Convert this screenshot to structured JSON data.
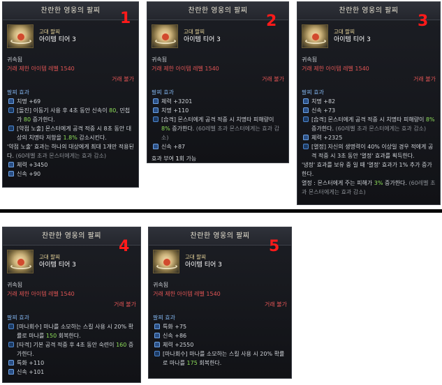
{
  "panels": [
    {
      "number": "1",
      "title": "찬란한 영웅의 팔찌",
      "grade": "고대 팔찌",
      "tier": "아이템 티어 3",
      "bound": "귀속됨",
      "req": "거래 제한 아이템 레벨 1540",
      "trade": "거래 불가",
      "effect_title": "팔찌 효과",
      "lines": [
        {
          "icon": "lock-icon",
          "text": "치명 +69"
        },
        {
          "icon": "effect-icon",
          "pre": "[돌진] 이동기 사용 후 4초 동안 신속이 ",
          "g1": "80",
          "mid": ", 민첩가 ",
          "g2": "80",
          "post": " 증가한다."
        },
        {
          "icon": "effect-icon",
          "pre": "[약점 노출] 몬스터에게 공격 적중 시 8초 동안 대상의 치명타 저항을 ",
          "g1": "1.8%",
          "post": " 감소시킨다."
        },
        {
          "icon": "",
          "text": "'약점 노출' 효과는 하나의 대상에게 최대 1개만 적용된다.",
          "sub": " (60레벨 초과 몬스터에게는 효과 감소)"
        },
        {
          "icon": "lock-icon",
          "text": "체력 +3450"
        },
        {
          "icon": "lock-icon",
          "text": "신속 +90"
        }
      ]
    },
    {
      "number": "2",
      "title": "찬란한 영웅의 팔찌",
      "grade": "고대 팔찌",
      "tier": "아이템 티어 3",
      "bound": "귀속됨",
      "req": "거래 제한 아이템 레벨 1540",
      "trade": "거래 불가",
      "effect_title": "팔찌 효과",
      "lines": [
        {
          "icon": "lock-icon",
          "text": "체력 +3201"
        },
        {
          "icon": "lock-icon",
          "text": "치명 +110"
        },
        {
          "icon": "effect-icon",
          "pre": "[습격] 몬스터에게 공격 적중 시 치명타 피해량이 ",
          "g1": "8%",
          "post": " 증가한다.",
          "sub": " (60레벨 초과 몬스터에게는 효과 감소)"
        },
        {
          "icon": "lock-icon",
          "text": "신속 +87"
        }
      ],
      "limit_pre": "효과 부여 ",
      "limit_n": "1",
      "limit_post": "회 가능"
    },
    {
      "number": "3",
      "title": "찬란한 영웅의 팔찌",
      "grade": "고대 팔찌",
      "tier": "아이템 티어 3",
      "bound": "귀속됨",
      "req": "거래 제한 아이템 레벨 1540",
      "trade": "거래 불가",
      "effect_title": "팔찌 효과",
      "lines": [
        {
          "icon": "lock-icon",
          "text": "치명 +82"
        },
        {
          "icon": "lock-icon",
          "text": "신속 +73"
        },
        {
          "icon": "effect-icon",
          "pre": "[습격] 몬스터에게 공격 적중 시 치명타 피해량이 ",
          "g1": "8%",
          "post": " 증가한다.",
          "sub": " (60레벨 초과 몬스터에게는 효과 감소)"
        },
        {
          "icon": "lock-icon",
          "text": "체력 +2325"
        },
        {
          "icon": "effect-icon",
          "text": "[열정] 자신의 생명력이 40% 이상일 경우 적에게 공격 적중 시 3초 동안 '열정' 효과를 획득한다."
        },
        {
          "icon": "",
          "text": "'냉정' 효과를 보유 중 일 때 '열정' 효과가 1% 추가 증가한다."
        },
        {
          "icon": "",
          "pre": "열정 : 몬스터에게 주는 피해가 ",
          "g1": "3%",
          "post": " 증가한다.",
          "sub": " (60레벨 초과 몬스터에게는 효과 감소)"
        }
      ]
    },
    {
      "number": "4",
      "title": "찬란한 영웅의 팔찌",
      "grade": "고대 팔찌",
      "tier": "아이템 티어 3",
      "bound": "귀속됨",
      "req": "거래 제한 아이템 레벨 1540",
      "trade": "거래 불가",
      "effect_title": "팔찌 효과",
      "lines": [
        {
          "icon": "effect-icon",
          "pre": "[마나회수] 마나를 소모하는 스킬 사용 시 20% 확률로 마나를 ",
          "g1": "150",
          "post": " 회복한다."
        },
        {
          "icon": "effect-icon",
          "pre": "[타격] 기본 공격 적중 후 4초 동안 숙련이 ",
          "g1": "160",
          "post": " 증가한다."
        },
        {
          "icon": "lock-icon",
          "text": "특화 +110"
        },
        {
          "icon": "lock-icon",
          "text": "신속 +101"
        }
      ]
    },
    {
      "number": "5",
      "title": "찬란한 영웅의 팔찌",
      "grade": "고대 팔찌",
      "tier": "아이템 티어 3",
      "bound": "귀속됨",
      "req": "거래 제한 아이템 레벨 1540",
      "trade": "거래 불가",
      "effect_title": "팔찌 효과",
      "lines": [
        {
          "icon": "lock-icon",
          "text": "특화 +75"
        },
        {
          "icon": "lock-icon",
          "text": "신속 +86"
        },
        {
          "icon": "lock-icon",
          "text": "체력 +2550"
        },
        {
          "icon": "effect-icon",
          "pre": "[마나회수] 마나를 소모하는 스킬 사용 시 20% 확률로 마나를 ",
          "g1": "175",
          "post": " 회복한다."
        }
      ]
    }
  ]
}
